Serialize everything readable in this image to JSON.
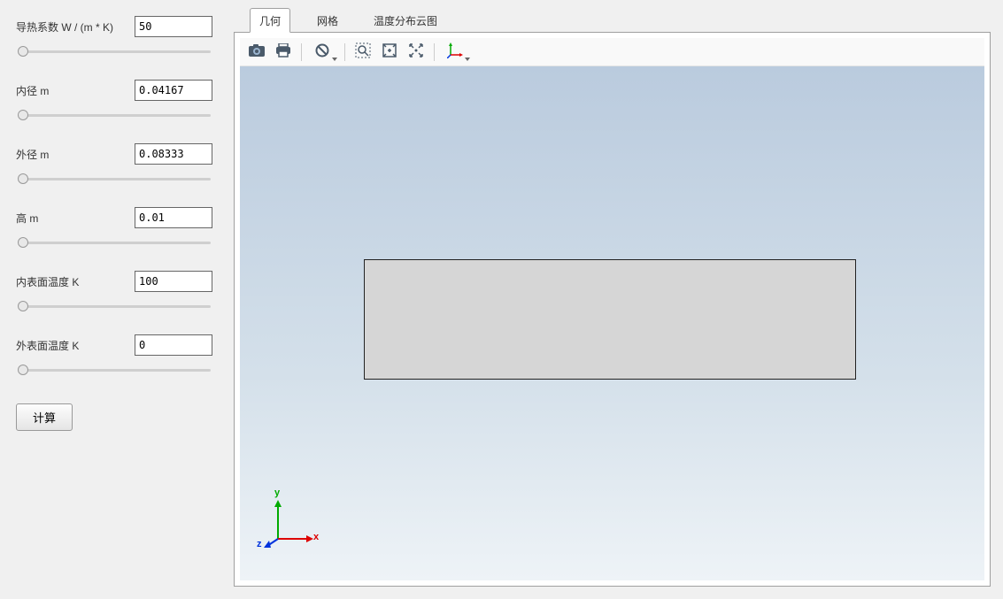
{
  "form": {
    "thermal_conductivity": {
      "label": "导热系数 W / (m * K)",
      "value": "50"
    },
    "inner_radius": {
      "label": "内径 m",
      "value": "0.04167"
    },
    "outer_radius": {
      "label": "外径 m",
      "value": "0.08333"
    },
    "height": {
      "label": "高 m",
      "value": "0.01"
    },
    "inner_temp": {
      "label": "内表面温度 K",
      "value": "100"
    },
    "outer_temp": {
      "label": "外表面温度 K",
      "value": "0"
    }
  },
  "compute_label": "计算",
  "tabs": {
    "geometry": "几何",
    "mesh": "网格",
    "contour": "温度分布云图"
  },
  "axes": {
    "y": "y",
    "x": "x",
    "z": "z"
  },
  "icons": {
    "snapshot": "snapshot-icon",
    "print": "print-icon",
    "view_reset": "view-reset-icon",
    "zoom_box": "zoom-box-icon",
    "zoom_extents": "zoom-extents-icon",
    "center": "center-icon",
    "axis_triad": "axis-triad-icon"
  }
}
